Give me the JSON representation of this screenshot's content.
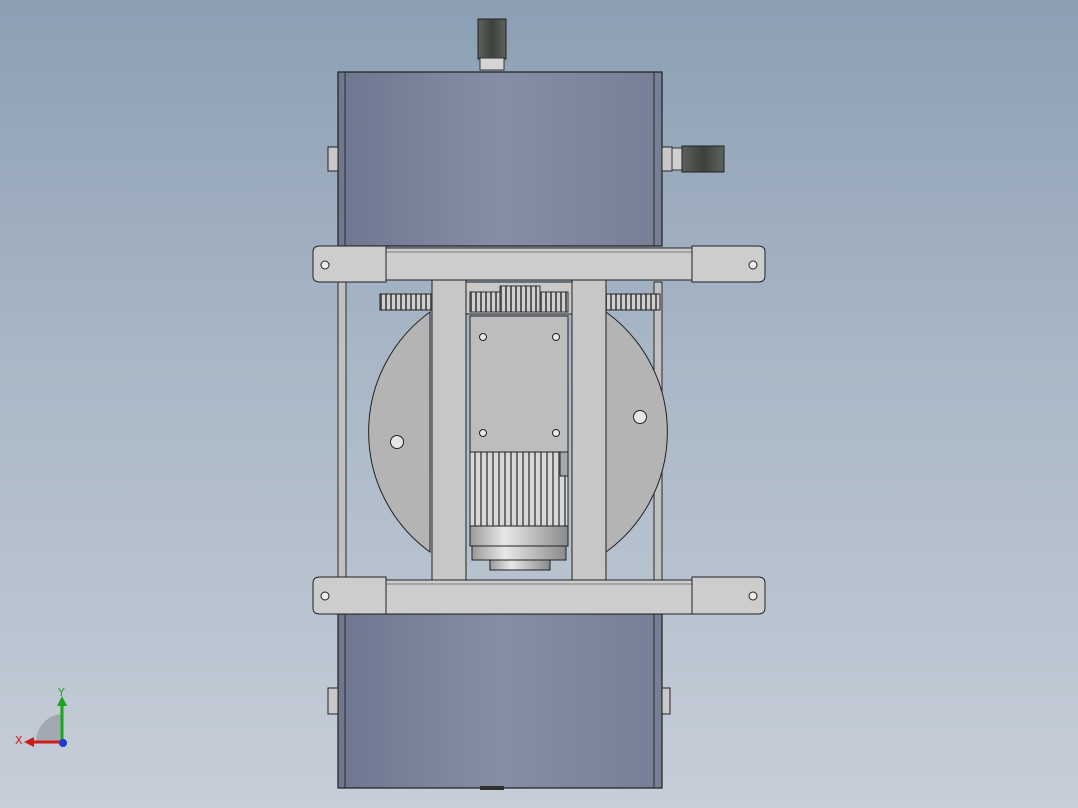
{
  "viewport": {
    "background_top": "#8c9fb4",
    "background_bottom": "#c6ced8"
  },
  "triad": {
    "x_label": "X",
    "y_label": "Y",
    "x_color": "#d11a1a",
    "y_color": "#1aa51a",
    "z_color": "#1a3ad1"
  },
  "model": {
    "housing_color": "#7f889f",
    "frame_color": "#c4c4c4",
    "disc_color": "#b3b3b3",
    "motor_color": "#4e534e"
  }
}
